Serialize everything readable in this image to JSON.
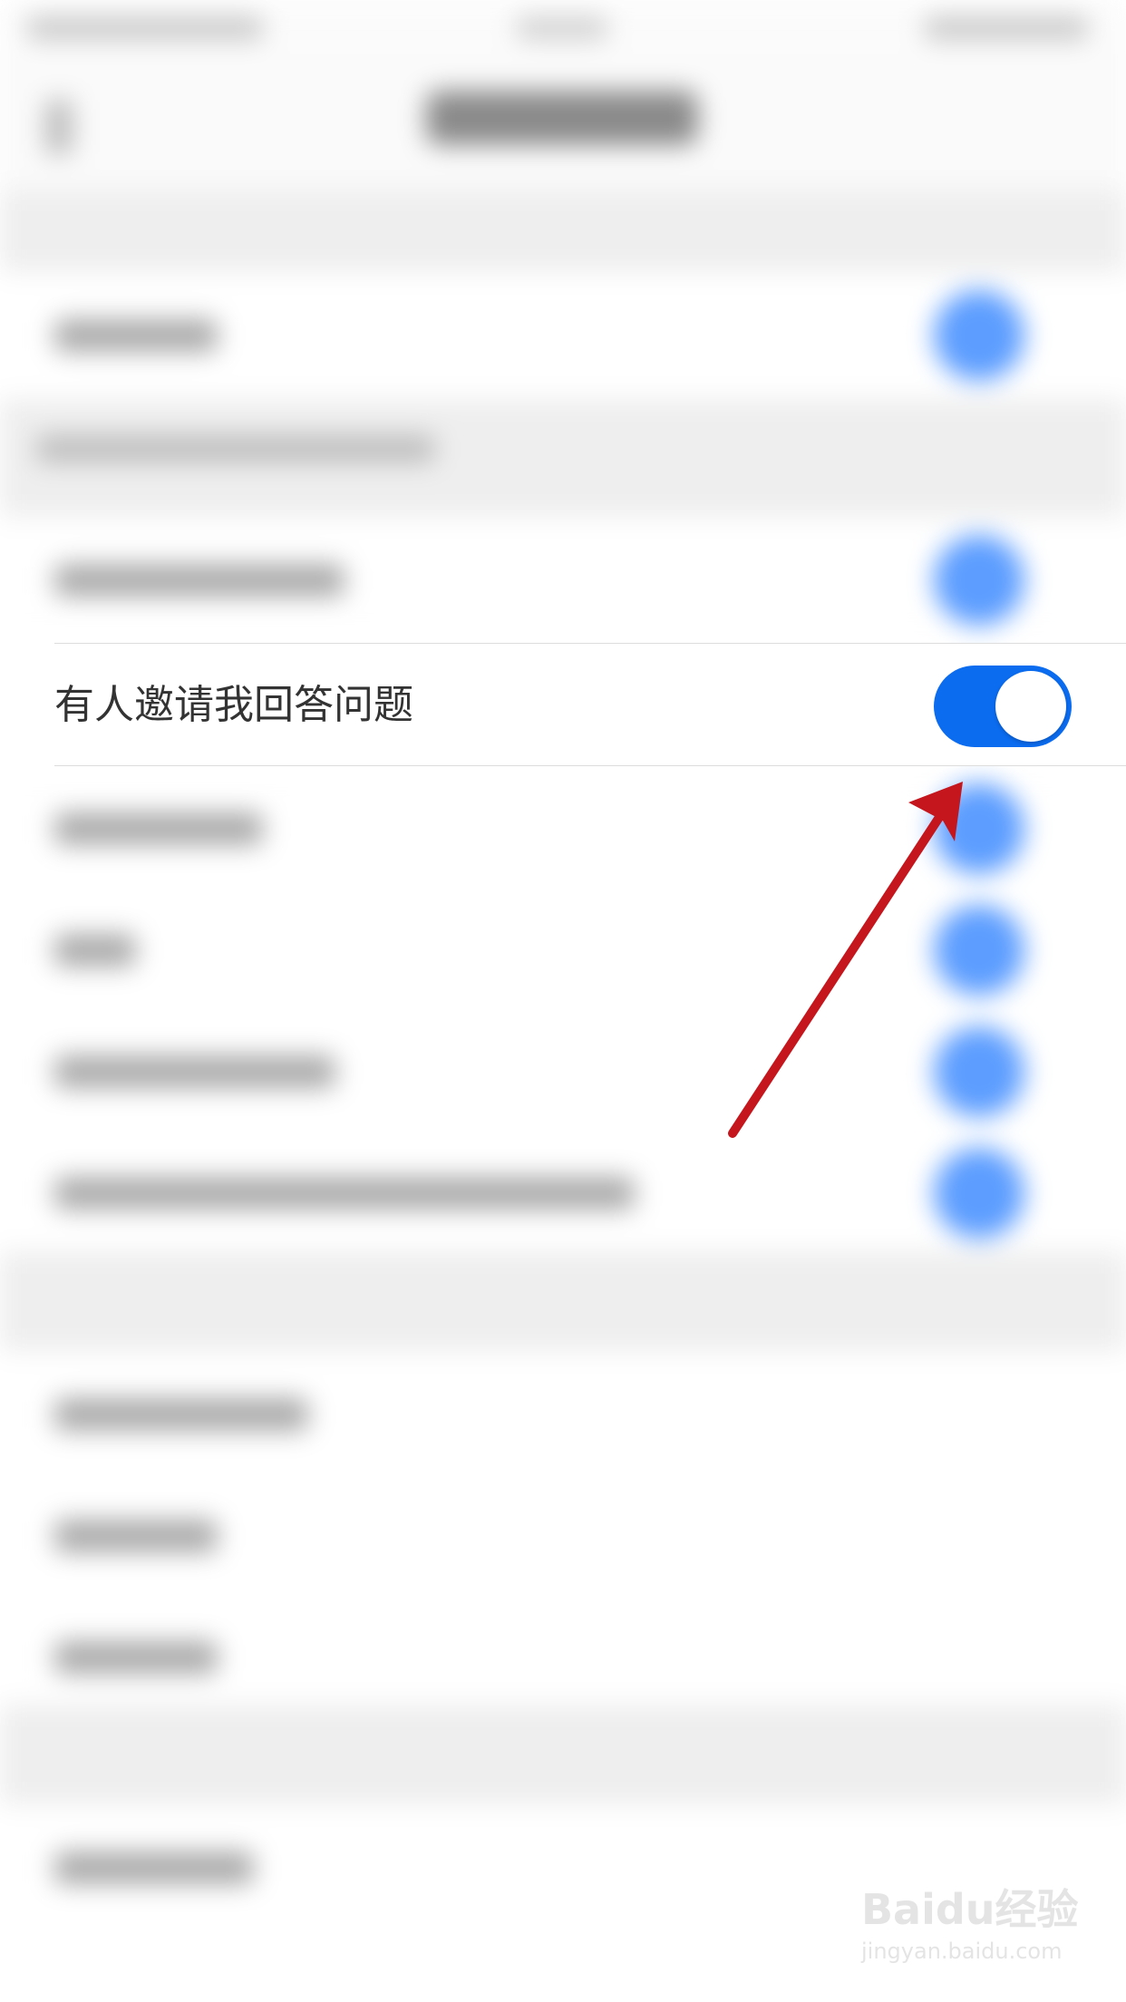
{
  "focused_row": {
    "label": "有人邀请我回答问题",
    "toggle_on": true
  },
  "colors": {
    "toggle_accent": "#0b6cf0",
    "annotation_arrow": "#c4161c"
  },
  "watermark": {
    "brand_text": "Baidu经验",
    "url_text": "jingyan.baidu.com"
  }
}
